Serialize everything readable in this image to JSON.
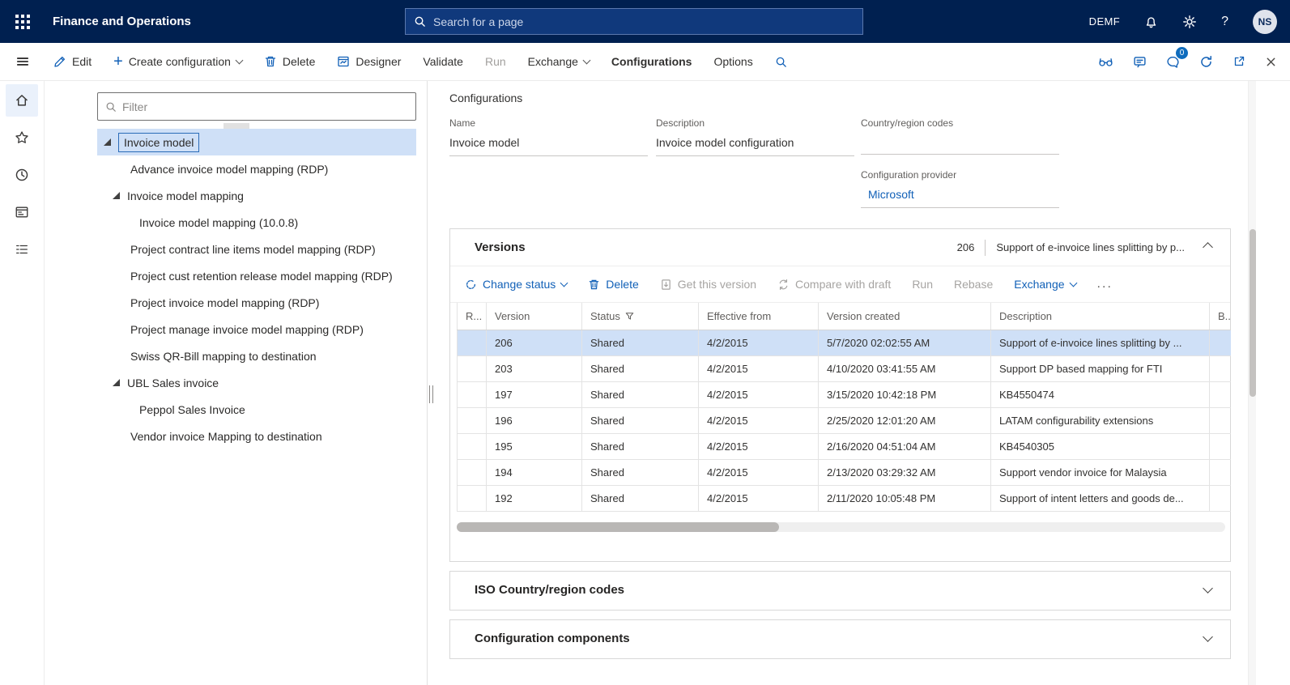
{
  "topbar": {
    "app_title": "Finance and Operations",
    "search_placeholder": "Search for a page",
    "company": "DEMF",
    "avatar_initials": "NS"
  },
  "action_bar": {
    "edit": "Edit",
    "create_configuration": "Create configuration",
    "delete": "Delete",
    "designer": "Designer",
    "validate": "Validate",
    "run": "Run",
    "exchange": "Exchange",
    "configurations": "Configurations",
    "options": "Options",
    "notification_count": "0"
  },
  "left_panel": {
    "filter_placeholder": "Filter",
    "tree": {
      "items": [
        {
          "label": "Invoice model",
          "level": 0,
          "expanded": true,
          "selected": true
        },
        {
          "label": "Advance invoice model mapping (RDP)",
          "level": 1
        },
        {
          "label": "Invoice model mapping",
          "level": 1,
          "expanded": true
        },
        {
          "label": "Invoice model mapping (10.0.8)",
          "level": 2
        },
        {
          "label": "Project contract line items model mapping (RDP)",
          "level": 1
        },
        {
          "label": "Project cust retention release model mapping (RDP)",
          "level": 1
        },
        {
          "label": "Project invoice model mapping (RDP)",
          "level": 1
        },
        {
          "label": "Project manage invoice model mapping (RDP)",
          "level": 1
        },
        {
          "label": "Swiss QR-Bill mapping to destination",
          "level": 1
        },
        {
          "label": "UBL Sales invoice",
          "level": 1,
          "expanded": true
        },
        {
          "label": "Peppol Sales Invoice",
          "level": 2
        },
        {
          "label": "Vendor invoice Mapping to destination",
          "level": 1
        }
      ]
    }
  },
  "main": {
    "page_title": "Configurations",
    "fields": {
      "name_label": "Name",
      "name_value": "Invoice model",
      "description_label": "Description",
      "description_value": "Invoice model configuration",
      "country_label": "Country/region codes",
      "country_value": "",
      "provider_label": "Configuration provider",
      "provider_value": "Microsoft"
    },
    "versions": {
      "title": "Versions",
      "header_version": "206",
      "header_description": "Support of e-invoice lines splitting by p...",
      "toolbar": {
        "change_status": "Change status",
        "delete": "Delete",
        "get_this_version": "Get this version",
        "compare_with_draft": "Compare with draft",
        "run": "Run",
        "rebase": "Rebase",
        "exchange": "Exchange",
        "more": "..."
      },
      "table": {
        "columns": [
          "R...",
          "Version",
          "Status",
          "Effective from",
          "Version created",
          "Description",
          "B..."
        ],
        "rows": [
          {
            "version": "206",
            "status": "Shared",
            "effective_from": "4/2/2015",
            "version_created": "5/7/2020 02:02:55 AM",
            "description": "Support of e-invoice lines splitting by ...",
            "selected": true
          },
          {
            "version": "203",
            "status": "Shared",
            "effective_from": "4/2/2015",
            "version_created": "4/10/2020 03:41:55 AM",
            "description": "Support DP based mapping for FTI",
            "selected": false
          },
          {
            "version": "197",
            "status": "Shared",
            "effective_from": "4/2/2015",
            "version_created": "3/15/2020 10:42:18 PM",
            "description": "KB4550474",
            "selected": false
          },
          {
            "version": "196",
            "status": "Shared",
            "effective_from": "4/2/2015",
            "version_created": "2/25/2020 12:01:20 AM",
            "description": "LATAM configurability extensions",
            "selected": false
          },
          {
            "version": "195",
            "status": "Shared",
            "effective_from": "4/2/2015",
            "version_created": "2/16/2020 04:51:04 AM",
            "description": "KB4540305",
            "selected": false
          },
          {
            "version": "194",
            "status": "Shared",
            "effective_from": "4/2/2015",
            "version_created": "2/13/2020 03:29:32 AM",
            "description": "Support vendor invoice for Malaysia",
            "selected": false
          },
          {
            "version": "192",
            "status": "Shared",
            "effective_from": "4/2/2015",
            "version_created": "2/11/2020 10:05:48 PM",
            "description": "Support of intent letters and goods de...",
            "selected": false
          }
        ]
      }
    },
    "sections": {
      "iso_codes": "ISO Country/region codes",
      "components": "Configuration components"
    }
  },
  "icons": [
    "waffle-icon",
    "search-icon",
    "bell-icon",
    "gear-icon",
    "help-icon",
    "hamburger-icon",
    "pencil-icon",
    "plus-icon",
    "trash-icon",
    "designer-icon",
    "glasses-icon",
    "feedback-icon",
    "chat-icon",
    "refresh-icon",
    "popout-icon",
    "close-icon",
    "home-icon",
    "star-icon",
    "clock-icon",
    "form-icon",
    "tasks-icon",
    "funnel-icon",
    "list-view-icon",
    "expand-arrow-icon",
    "chevron-icon",
    "change-status-icon",
    "get-version-icon",
    "compare-icon"
  ],
  "colors": {
    "header_bg": "#002050",
    "accent": "#1160b7",
    "selected_row_bg": "#cfe0f7",
    "disabled_text": "#a19f9d"
  }
}
